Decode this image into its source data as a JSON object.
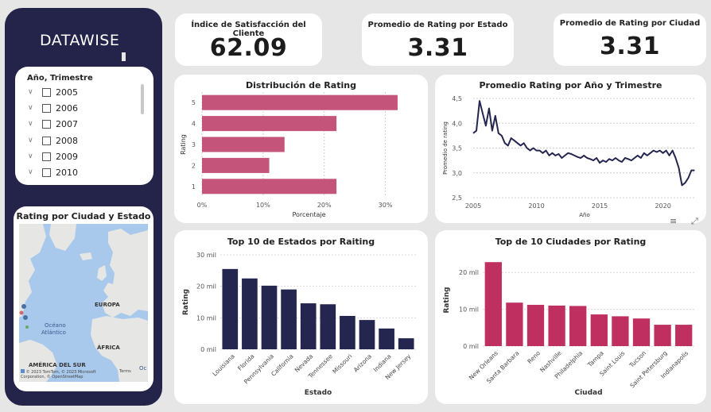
{
  "brand": {
    "name": "DATAWISE"
  },
  "slicer": {
    "title": "Año, Trimestre",
    "items": [
      "2005",
      "2006",
      "2007",
      "2008",
      "2009",
      "2010"
    ]
  },
  "map": {
    "title": "Rating por Ciudad y Estado",
    "labels": {
      "europa": "EUROPA",
      "oceano": "Océano",
      "atlantico": "Atlántico",
      "africa": "ÁFRICA",
      "america_sur": "AMÉRICA DEL SUR",
      "oc": "Oc"
    },
    "attribution": "© 2023 TomTom, © 2023 Microsoft Corporation, © OpenStreetMap",
    "terms": "Terms"
  },
  "kpis": [
    {
      "title": "Índice de Satisfacción del Cliente",
      "value": "62.09"
    },
    {
      "title": "Promedio de Rating por Estado",
      "value": "3.31"
    },
    {
      "title": "Promedio de Rating por Ciudad",
      "value": "3.31"
    }
  ],
  "colors": {
    "pink": "#c4547a",
    "navy": "#252650",
    "crimson": "#bf2f5f",
    "line": "#252650"
  },
  "chart_data": [
    {
      "type": "bar",
      "orientation": "horizontal",
      "title": "Distribución de Rating",
      "xlabel": "Porcentaje",
      "ylabel": "Rating",
      "categories": [
        "5",
        "4",
        "3",
        "2",
        "1"
      ],
      "values": [
        32,
        22,
        13.5,
        11,
        22
      ],
      "xlim": [
        0,
        35
      ],
      "xticks": [
        "0%",
        "10%",
        "20%",
        "30%"
      ],
      "xtick_values": [
        0,
        10,
        20,
        30
      ],
      "grid": true
    },
    {
      "type": "line",
      "title": "Promedio Rating por Año y Trimestre",
      "xlabel": "Año",
      "ylabel": "Promedio de rating",
      "ylim": [
        2.5,
        4.5
      ],
      "xlim": [
        2005,
        2022.6
      ],
      "xticks": [
        2005,
        2010,
        2015,
        2020
      ],
      "yticks": [
        "2,5",
        "3,0",
        "3,5",
        "4,0",
        "4,5"
      ],
      "ytick_values": [
        2.5,
        3.0,
        3.5,
        4.0,
        4.5
      ],
      "x": [
        2005.0,
        2005.25,
        2005.5,
        2005.75,
        2006.0,
        2006.25,
        2006.5,
        2006.75,
        2007.0,
        2007.25,
        2007.5,
        2007.75,
        2008.0,
        2008.25,
        2008.5,
        2008.75,
        2009.0,
        2009.25,
        2009.5,
        2009.75,
        2010.0,
        2010.25,
        2010.5,
        2010.75,
        2011.0,
        2011.25,
        2011.5,
        2011.75,
        2012.0,
        2012.25,
        2012.5,
        2012.75,
        2013.0,
        2013.25,
        2013.5,
        2013.75,
        2014.0,
        2014.25,
        2014.5,
        2014.75,
        2015.0,
        2015.25,
        2015.5,
        2015.75,
        2016.0,
        2016.25,
        2016.5,
        2016.75,
        2017.0,
        2017.25,
        2017.5,
        2017.75,
        2018.0,
        2018.25,
        2018.5,
        2018.75,
        2019.0,
        2019.25,
        2019.5,
        2019.75,
        2020.0,
        2020.25,
        2020.5,
        2020.75,
        2021.0,
        2021.25,
        2021.5,
        2021.75,
        2022.0,
        2022.25,
        2022.5
      ],
      "y": [
        3.8,
        3.85,
        4.45,
        4.2,
        3.95,
        4.3,
        3.85,
        4.15,
        3.8,
        3.75,
        3.6,
        3.55,
        3.7,
        3.65,
        3.6,
        3.55,
        3.6,
        3.5,
        3.45,
        3.5,
        3.45,
        3.45,
        3.4,
        3.45,
        3.35,
        3.4,
        3.35,
        3.38,
        3.3,
        3.35,
        3.4,
        3.38,
        3.35,
        3.32,
        3.3,
        3.35,
        3.3,
        3.28,
        3.25,
        3.3,
        3.2,
        3.25,
        3.22,
        3.28,
        3.25,
        3.3,
        3.25,
        3.22,
        3.3,
        3.28,
        3.25,
        3.3,
        3.35,
        3.3,
        3.4,
        3.35,
        3.4,
        3.45,
        3.42,
        3.45,
        3.4,
        3.45,
        3.35,
        3.45,
        3.3,
        3.1,
        2.75,
        2.8,
        2.9,
        3.05,
        3.05
      ]
    },
    {
      "type": "bar",
      "title": "Top 10 de Estados por Raiting",
      "xlabel": "Estado",
      "ylabel": "Rating",
      "categories": [
        "Louisiana",
        "Florida",
        "Pennsylvania",
        "California",
        "Nevada",
        "Tennessee",
        "Missouri",
        "Arizona",
        "Indiana",
        "New Jersey"
      ],
      "values": [
        25500,
        22500,
        20200,
        19000,
        14600,
        14300,
        10600,
        9300,
        6600,
        3500
      ],
      "ylim": [
        0,
        30000
      ],
      "yticks": [
        "0 mil",
        "10 mil",
        "20 mil",
        "30 mil"
      ],
      "ytick_values": [
        0,
        10000,
        20000,
        30000
      ]
    },
    {
      "type": "bar",
      "title": "Top de 10 Ciudades por Rating",
      "xlabel": "Ciudad",
      "ylabel": "Rating",
      "categories": [
        "New Orleans",
        "Santa Barbara",
        "Reno",
        "Nashville",
        "Philadelphia",
        "Tampa",
        "Saint Louis",
        "Tucson",
        "Saint Petersburg",
        "Indianapolis"
      ],
      "values": [
        22800,
        11800,
        11200,
        11000,
        10900,
        8600,
        8100,
        7500,
        5800,
        5800
      ],
      "ylim": [
        0,
        25000
      ],
      "yticks": [
        "0 mil",
        "10 mil",
        "20 mil"
      ],
      "ytick_values": [
        0,
        10000,
        20000
      ]
    }
  ]
}
